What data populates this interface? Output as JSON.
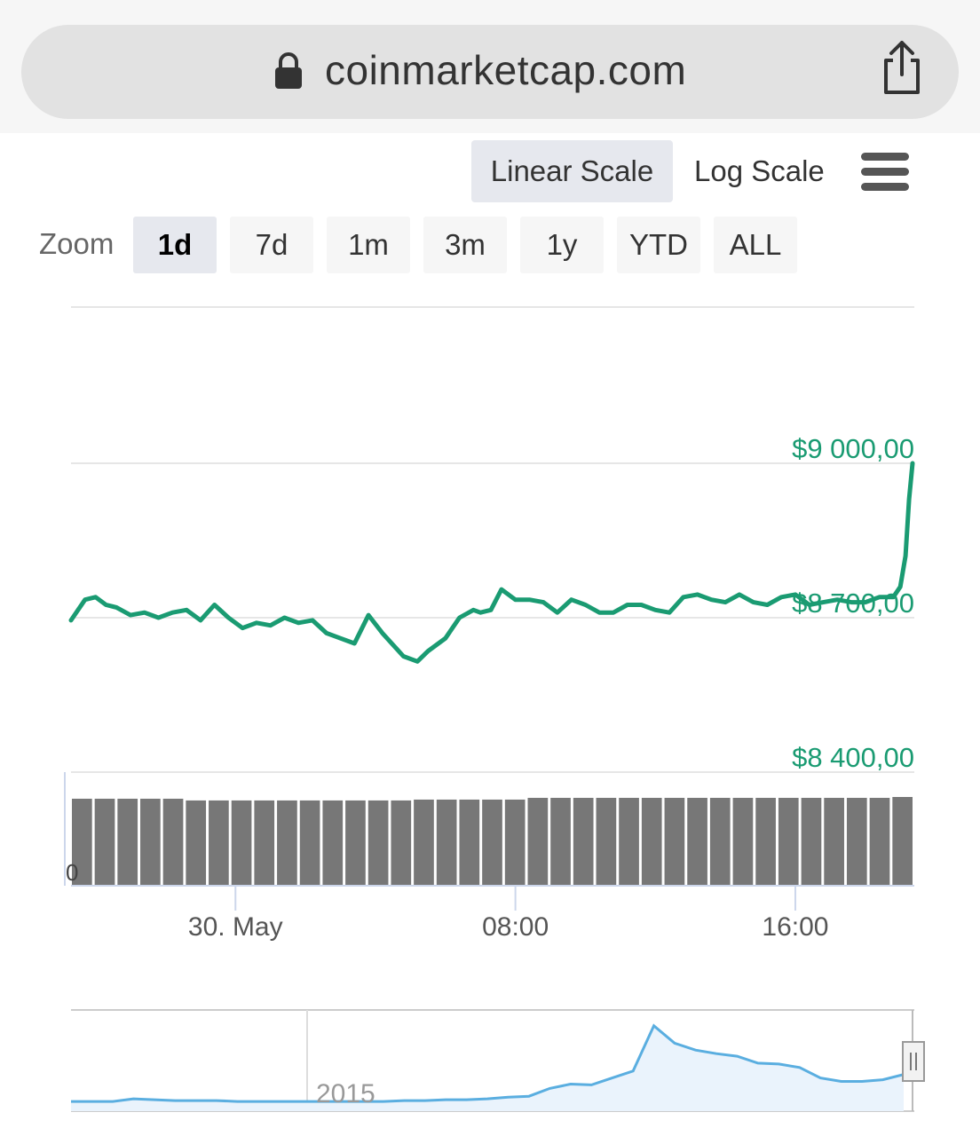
{
  "browser": {
    "url": "coinmarketcap.com",
    "icons": {
      "lock": "lock-icon",
      "share": "share-icon"
    }
  },
  "controls": {
    "linear_scale": "Linear Scale",
    "log_scale": "Log Scale",
    "menu_icon": "hamburger-menu-icon",
    "zoom_label": "Zoom",
    "zoom_buttons": [
      "1d",
      "7d",
      "1m",
      "3m",
      "1y",
      "YTD",
      "ALL"
    ],
    "zoom_active": "1d"
  },
  "colors": {
    "price_line": "#1a9b72",
    "volume_bar": "#777777",
    "navigator_line": "#5aaee0",
    "navigator_fill": "#eaf3fc"
  },
  "chart_data": {
    "type": "line",
    "title": "",
    "ylim": [
      8400,
      9000
    ],
    "y_ticks": [
      "$9 000,00",
      "$8 700,00",
      "$8 400,00"
    ],
    "y_tick_values": [
      9000,
      8700,
      8400
    ],
    "x_tick_labels": [
      "30. May",
      "08:00",
      "16:00"
    ],
    "x_tick_hours": [
      0,
      8,
      16
    ],
    "x_range_hours": [
      -4.7,
      19.4
    ],
    "series": [
      {
        "x_hours": [
          -4.7,
          -4.3,
          -4.0,
          -3.7,
          -3.4,
          -3.0,
          -2.6,
          -2.2,
          -1.8,
          -1.4,
          -1.0,
          -0.6,
          -0.2,
          0.2,
          0.6,
          1.0,
          1.4,
          1.8,
          2.2,
          2.6,
          3.0,
          3.4,
          3.8,
          4.2,
          4.6,
          4.8,
          5.2,
          5.5,
          6.0,
          6.4,
          6.8,
          7.0,
          7.3,
          7.6,
          8.0,
          8.4,
          8.8,
          9.2,
          9.6,
          10.0,
          10.4,
          10.8,
          11.2,
          11.6,
          12.0,
          12.4,
          12.8,
          13.2,
          13.6,
          14.0,
          14.4,
          14.8,
          15.2,
          15.6,
          16.0,
          16.4,
          16.8,
          17.2,
          17.6,
          18.0,
          18.4,
          18.8,
          19.0,
          19.15,
          19.25,
          19.35
        ],
        "values": [
          8695,
          8735,
          8740,
          8725,
          8720,
          8705,
          8710,
          8700,
          8710,
          8715,
          8695,
          8725,
          8700,
          8680,
          8690,
          8685,
          8700,
          8690,
          8695,
          8670,
          8660,
          8650,
          8705,
          8670,
          8640,
          8625,
          8615,
          8635,
          8660,
          8700,
          8715,
          8710,
          8715,
          8755,
          8735,
          8735,
          8730,
          8710,
          8735,
          8725,
          8710,
          8710,
          8725,
          8725,
          8715,
          8710,
          8740,
          8745,
          8735,
          8730,
          8745,
          8730,
          8725,
          8740,
          8745,
          8725,
          8730,
          8735,
          8730,
          8730,
          8740,
          8740,
          8760,
          8820,
          8930,
          9000
        ]
      }
    ],
    "volume": {
      "values": [
        100,
        100,
        100,
        100,
        100,
        98,
        98,
        98,
        98,
        98,
        98,
        98,
        98,
        98,
        98,
        99,
        99,
        99,
        99,
        99,
        101,
        101,
        101,
        101,
        101,
        101,
        101,
        101,
        101,
        101,
        101,
        101,
        101,
        101,
        101,
        101,
        102
      ]
    },
    "navigator": {
      "label": "2015",
      "values": [
        0.03,
        0.03,
        0.03,
        0.06,
        0.05,
        0.04,
        0.04,
        0.04,
        0.03,
        0.03,
        0.03,
        0.03,
        0.03,
        0.03,
        0.03,
        0.03,
        0.04,
        0.04,
        0.05,
        0.05,
        0.06,
        0.08,
        0.09,
        0.18,
        0.23,
        0.22,
        0.3,
        0.38,
        0.9,
        0.7,
        0.62,
        0.58,
        0.55,
        0.47,
        0.46,
        0.42,
        0.3,
        0.26,
        0.26,
        0.28,
        0.34
      ]
    }
  }
}
